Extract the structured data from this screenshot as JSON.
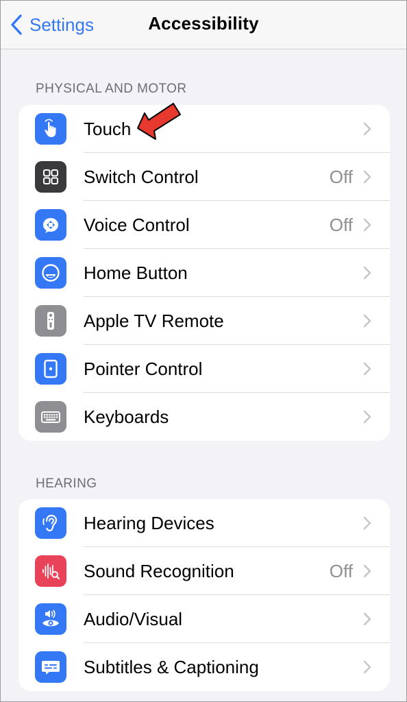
{
  "nav": {
    "back_label": "Settings",
    "title": "Accessibility"
  },
  "sections": [
    {
      "header": "PHYSICAL AND MOTOR",
      "items": [
        {
          "label": "Touch",
          "value": "",
          "icon": "touch-hand-icon",
          "color": "#3478f6"
        },
        {
          "label": "Switch Control",
          "value": "Off",
          "icon": "switch-control-grid-icon",
          "color": "#3a3a3c"
        },
        {
          "label": "Voice Control",
          "value": "Off",
          "icon": "voice-control-icon",
          "color": "#3478f6"
        },
        {
          "label": "Home Button",
          "value": "",
          "icon": "home-button-icon",
          "color": "#3478f6"
        },
        {
          "label": "Apple TV Remote",
          "value": "",
          "icon": "tv-remote-icon",
          "color": "#8e8e93"
        },
        {
          "label": "Pointer Control",
          "value": "",
          "icon": "pointer-control-icon",
          "color": "#3478f6"
        },
        {
          "label": "Keyboards",
          "value": "",
          "icon": "keyboard-icon",
          "color": "#8e8e93"
        }
      ]
    },
    {
      "header": "HEARING",
      "items": [
        {
          "label": "Hearing Devices",
          "value": "",
          "icon": "ear-icon",
          "color": "#3478f6"
        },
        {
          "label": "Sound Recognition",
          "value": "Off",
          "icon": "sound-recognition-icon",
          "color": "#e9435a"
        },
        {
          "label": "Audio/Visual",
          "value": "",
          "icon": "audio-visual-icon",
          "color": "#3478f6"
        },
        {
          "label": "Subtitles & Captioning",
          "value": "",
          "icon": "subtitles-icon",
          "color": "#3478f6"
        }
      ]
    }
  ],
  "annotation": {
    "icon": "red-arrow-icon",
    "color": "#e8392f"
  }
}
